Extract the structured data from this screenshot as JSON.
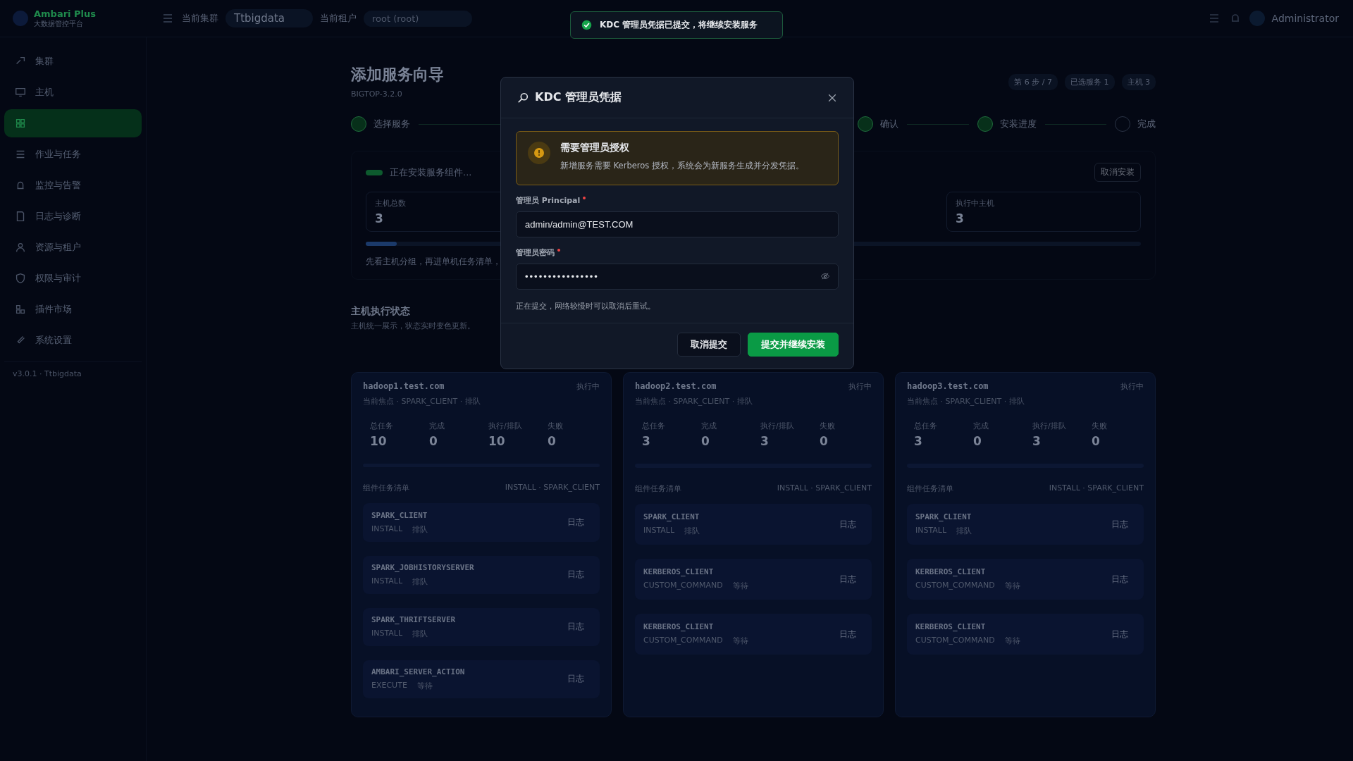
{
  "app": {
    "name": "Ambari Plus",
    "subtitle": "大数据管控平台",
    "version": "v3.0.1 · Ttbigdata"
  },
  "topbar": {
    "cluster_label": "当前集群",
    "cluster": "Ttbigdata",
    "tenant_label": "当前租户",
    "tenant": "root (root)",
    "user": "Administrator"
  },
  "sidebar": [
    {
      "label": "集群",
      "selected": false
    },
    {
      "label": "主机",
      "selected": false
    },
    {
      "selected": true
    },
    {
      "label": "作业与任务",
      "selected": false
    },
    {
      "label": "监控与告警",
      "selected": false
    },
    {
      "label": "日志与诊断",
      "selected": false
    },
    {
      "label": "资源与租户",
      "selected": false
    },
    {
      "label": "权限与审计",
      "selected": false
    },
    {
      "label": "插件市场",
      "selected": false
    },
    {
      "label": "系统设置",
      "selected": false
    }
  ],
  "page": {
    "title": "添加服务向导",
    "subtitle": "BIGTOP-3.2.0",
    "chips": [
      "第 6 步 / 7",
      "已选服务 1",
      "主机 3"
    ]
  },
  "steps": [
    {
      "label": "选择服务",
      "done": true
    },
    {
      "label": "确认",
      "done": true
    },
    {
      "label": "安装进度",
      "done": true
    },
    {
      "label": "完成",
      "done": false
    }
  ],
  "install": {
    "status": "正在安装服务组件...",
    "cancel": "取消安装",
    "stats": [
      {
        "label": "主机总数",
        "value": "3"
      },
      {
        "label": "执行中主机",
        "value": "3"
      }
    ],
    "level": 0.04,
    "hint": "先看主机分组，再进单机任务清单，"
  },
  "hosts_section": {
    "title": "主机执行状态",
    "subtitle": "主机统一展示，状态实时变色更新。"
  },
  "hosts": [
    {
      "name": "hadoop1.test.com",
      "status": "执行中",
      "focus": "当前焦点 · SPARK_CLIENT · 排队",
      "stats": [
        {
          "label": "总任务",
          "value": "10"
        },
        {
          "label": "完成",
          "value": "0"
        },
        {
          "label": "执行/排队",
          "value": "10"
        },
        {
          "label": "失败",
          "value": "0"
        }
      ],
      "list_title": "组件任务清单",
      "list_tag": "INSTALL · SPARK_CLIENT",
      "tasks": [
        {
          "name": "SPARK_CLIENT",
          "command": "INSTALL",
          "state": "排队",
          "log": "日志"
        },
        {
          "name": "SPARK_JOBHISTORYSERVER",
          "command": "INSTALL",
          "state": "排队",
          "log": "日志"
        },
        {
          "name": "SPARK_THRIFTSERVER",
          "command": "INSTALL",
          "state": "排队",
          "log": "日志"
        },
        {
          "name": "AMBARI_SERVER_ACTION",
          "command": "EXECUTE",
          "state": "等待",
          "log": "日志"
        }
      ]
    },
    {
      "name": "hadoop2.test.com",
      "status": "执行中",
      "focus": "当前焦点 · SPARK_CLIENT · 排队",
      "stats": [
        {
          "label": "总任务",
          "value": "3"
        },
        {
          "label": "完成",
          "value": "0"
        },
        {
          "label": "执行/排队",
          "value": "3"
        },
        {
          "label": "失败",
          "value": "0"
        }
      ],
      "list_title": "组件任务清单",
      "list_tag": "INSTALL · SPARK_CLIENT",
      "tasks": [
        {
          "name": "SPARK_CLIENT",
          "command": "INSTALL",
          "state": "排队",
          "log": "日志"
        },
        {
          "name": "KERBEROS_CLIENT",
          "command": "CUSTOM_COMMAND",
          "state": "等待",
          "log": "日志"
        },
        {
          "name": "KERBEROS_CLIENT",
          "command": "CUSTOM_COMMAND",
          "state": "等待",
          "log": "日志"
        }
      ]
    },
    {
      "name": "hadoop3.test.com",
      "status": "执行中",
      "focus": "当前焦点 · SPARK_CLIENT · 排队",
      "stats": [
        {
          "label": "总任务",
          "value": "3"
        },
        {
          "label": "完成",
          "value": "0"
        },
        {
          "label": "执行/排队",
          "value": "3"
        },
        {
          "label": "失败",
          "value": "0"
        }
      ],
      "list_title": "组件任务清单",
      "list_tag": "INSTALL · SPARK_CLIENT",
      "tasks": [
        {
          "name": "SPARK_CLIENT",
          "command": "INSTALL",
          "state": "排队",
          "log": "日志"
        },
        {
          "name": "KERBEROS_CLIENT",
          "command": "CUSTOM_COMMAND",
          "state": "等待",
          "log": "日志"
        },
        {
          "name": "KERBEROS_CLIENT",
          "command": "CUSTOM_COMMAND",
          "state": "等待",
          "log": "日志"
        }
      ]
    }
  ],
  "toast": {
    "kind": "success",
    "text": "KDC 管理员凭据已提交，将继续安装服务"
  },
  "modal": {
    "title": "KDC 管理员凭据",
    "alert": {
      "title": "需要管理员授权",
      "text": "新增服务需要 Kerberos 授权，系统会为新服务生成并分发凭据。"
    },
    "fields": [
      {
        "kind": "text",
        "label": "管理员 Principal",
        "required": true,
        "value": "admin/admin@TEST.COM"
      },
      {
        "kind": "password",
        "label": "管理员密码",
        "required": true,
        "value": "••••••••••••••••"
      }
    ],
    "note": "正在提交，网络较慢时可以取消后重试。",
    "buttons": [
      {
        "label": "取消提交",
        "primary": false
      },
      {
        "label": "提交并继续安装",
        "primary": true
      }
    ]
  }
}
